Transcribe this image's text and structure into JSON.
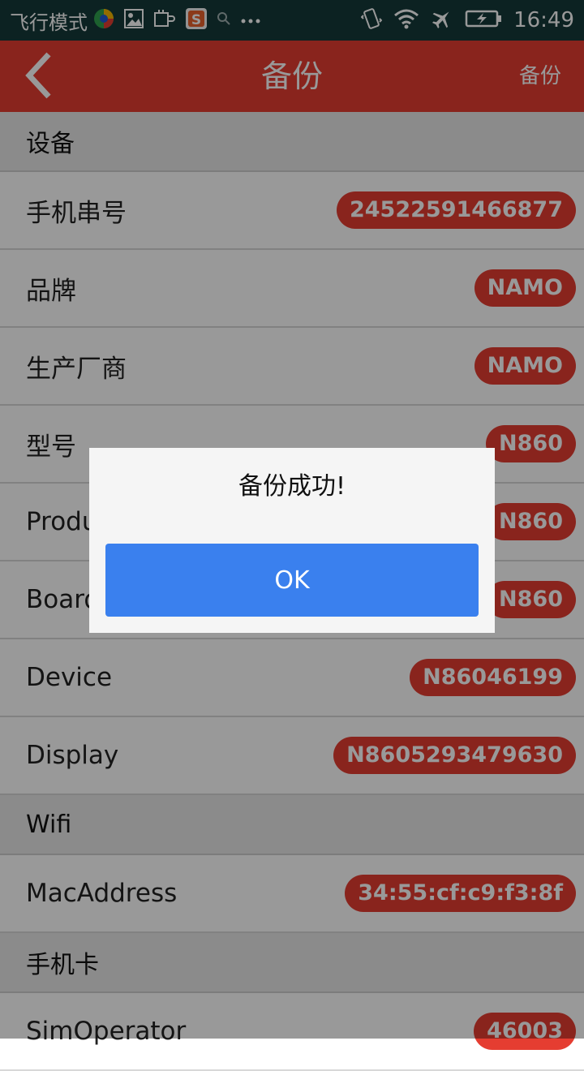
{
  "status_bar": {
    "mode_text": "飞行模式",
    "time": "16:49",
    "left_icons": [
      "browser-icon",
      "image-icon",
      "mug-icon",
      "sogou-s-icon",
      "search-icon",
      "more-dots-icon"
    ],
    "right_icons": [
      "vibrate-icon",
      "wifi-icon",
      "airplane-icon",
      "battery-charging-icon"
    ]
  },
  "app_bar": {
    "back_icon": "chevron-left-icon",
    "title": "备份",
    "action_label": "备份",
    "color": "#e53d31"
  },
  "list": {
    "sections": [
      {
        "title": "设备",
        "rows": [
          {
            "label": "手机串号",
            "value": "24522591466877"
          },
          {
            "label": "品牌",
            "value": "NAMO"
          },
          {
            "label": "生产厂商",
            "value": "NAMO"
          },
          {
            "label": "型号",
            "value": "N860"
          },
          {
            "label": "Product",
            "value": "N860"
          },
          {
            "label": "Board",
            "value": "N860"
          },
          {
            "label": "Device",
            "value": "N86046199"
          },
          {
            "label": "Display",
            "value": "N8605293479630"
          }
        ]
      },
      {
        "title": "Wifi",
        "rows": [
          {
            "label": "MacAddress",
            "value": "34:55:cf:c9:f3:8f"
          }
        ]
      },
      {
        "title": "手机卡",
        "rows": [
          {
            "label": "SimOperator",
            "value": "46003"
          }
        ]
      }
    ]
  },
  "dialog": {
    "message": "备份成功!",
    "ok_label": "OK",
    "button_color": "#3a80ee"
  }
}
